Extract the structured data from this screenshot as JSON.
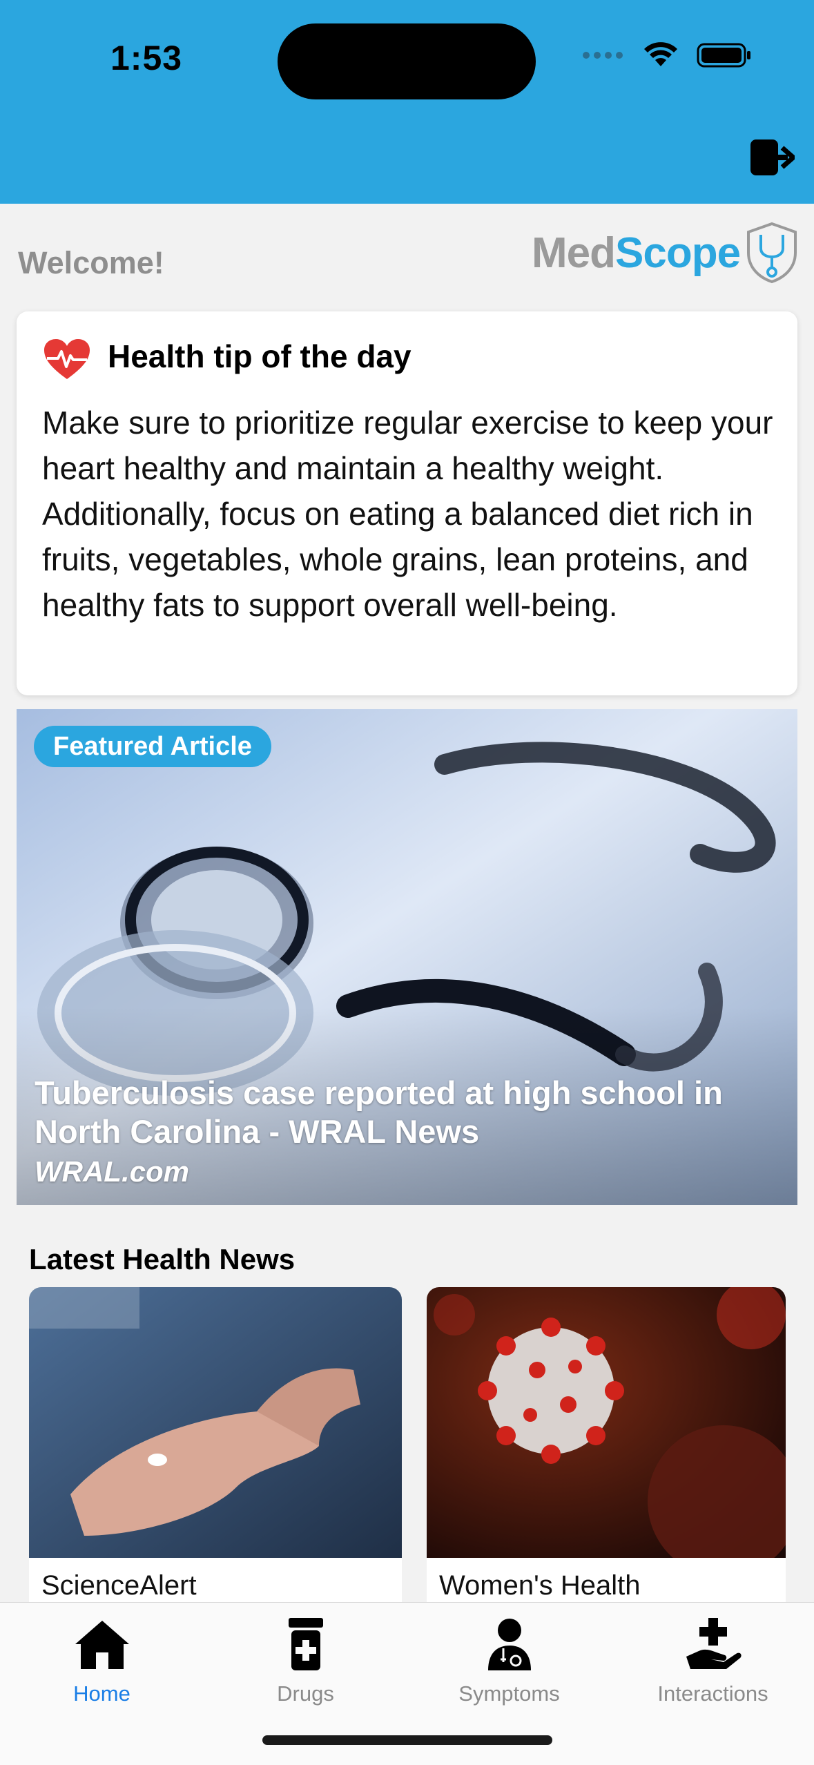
{
  "status_bar": {
    "time": "1:53"
  },
  "welcome": "Welcome!",
  "brand": {
    "part1": "Med",
    "part2": "Scope"
  },
  "tip": {
    "title": "Health tip of the day",
    "body": "Make sure to prioritize regular exercise to keep your heart healthy and maintain a healthy weight. Additionally, focus on eating a balanced diet rich in fruits, vegetables, whole grains, lean proteins, and healthy fats to support overall well-being."
  },
  "featured": {
    "badge": "Featured Article",
    "title": "Tuberculosis case reported at high school in North Carolina - WRAL News",
    "source": "WRAL.com"
  },
  "news": {
    "heading": "Latest Health News",
    "items": [
      {
        "source": "ScienceAlert"
      },
      {
        "source": "Women's Health"
      }
    ]
  },
  "tabs": [
    {
      "label": "Home",
      "icon": "home-icon",
      "active": true
    },
    {
      "label": "Drugs",
      "icon": "pill-bottle-icon",
      "active": false
    },
    {
      "label": "Symptoms",
      "icon": "doctor-icon",
      "active": false
    },
    {
      "label": "Interactions",
      "icon": "hand-medical-icon",
      "active": false
    }
  ],
  "colors": {
    "accent": "#2ba6df",
    "active_tab": "#1a7ee6",
    "heart": "#e53935"
  }
}
